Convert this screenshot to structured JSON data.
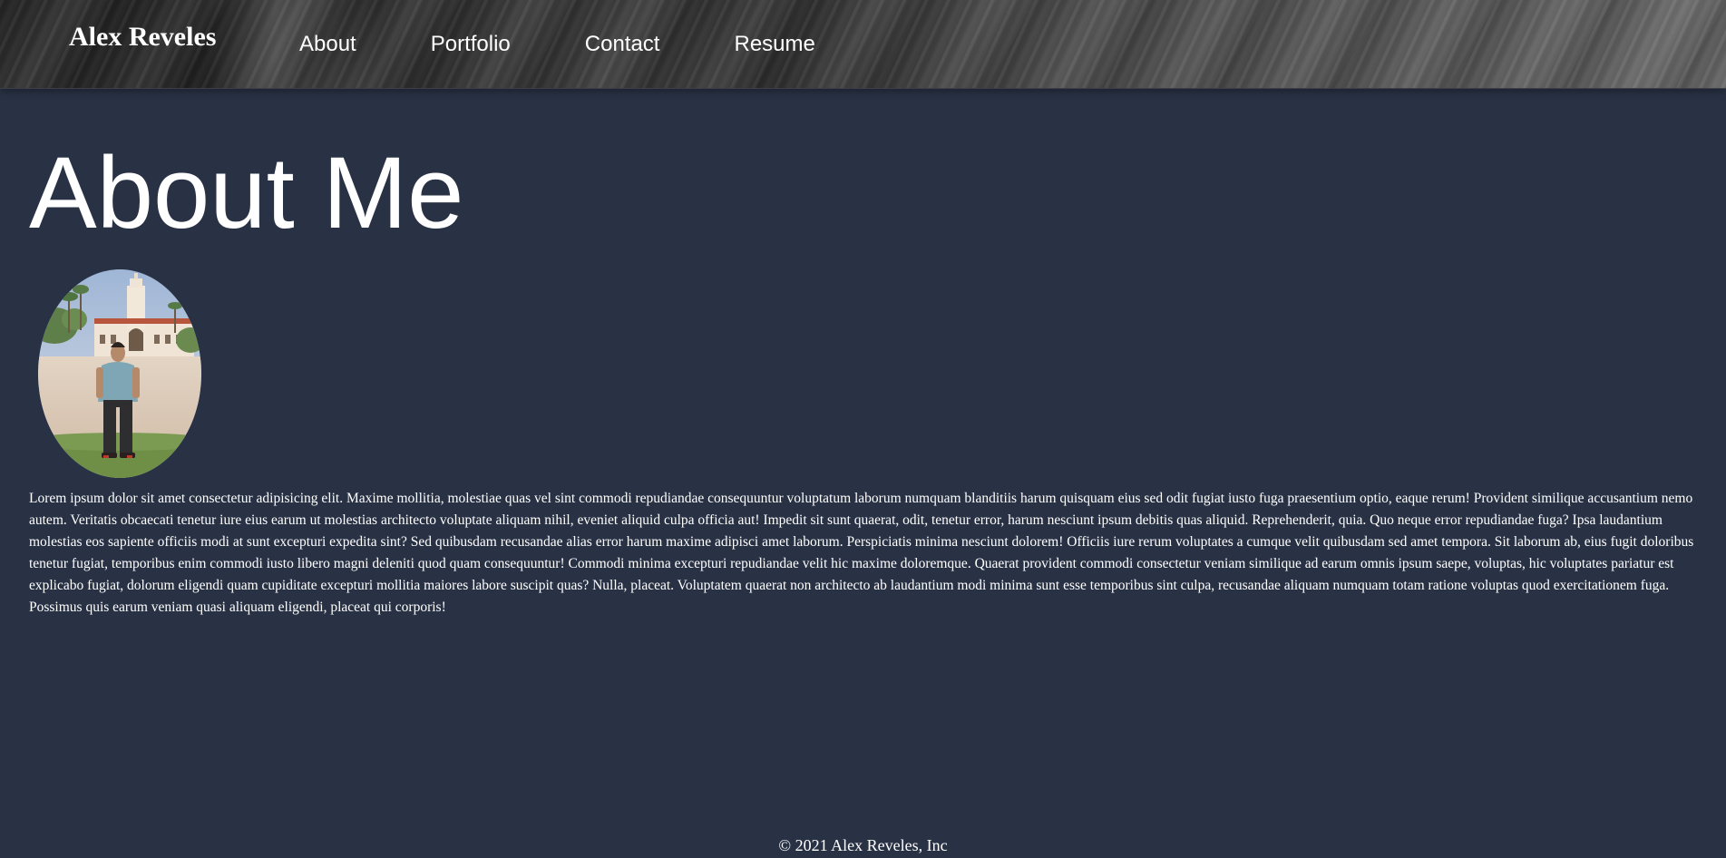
{
  "header": {
    "brand": "Alex Reveles",
    "nav": [
      {
        "label": "About"
      },
      {
        "label": "Portfolio"
      },
      {
        "label": "Contact"
      },
      {
        "label": "Resume"
      }
    ]
  },
  "main": {
    "title": "About Me",
    "photo_icon": "profile-photo",
    "bio": "Lorem ipsum dolor sit amet consectetur adipisicing elit. Maxime mollitia, molestiae quas vel sint commodi repudiandae consequuntur voluptatum laborum numquam blanditiis harum quisquam eius sed odit fugiat iusto fuga praesentium optio, eaque rerum! Provident similique accusantium nemo autem. Veritatis obcaecati tenetur iure eius earum ut molestias architecto voluptate aliquam nihil, eveniet aliquid culpa officia aut! Impedit sit sunt quaerat, odit, tenetur error, harum nesciunt ipsum debitis quas aliquid. Reprehenderit, quia. Quo neque error repudiandae fuga? Ipsa laudantium molestias eos sapiente officiis modi at sunt excepturi expedita sint? Sed quibusdam recusandae alias error harum maxime adipisci amet laborum. Perspiciatis minima nesciunt dolorem! Officiis iure rerum voluptates a cumque velit quibusdam sed amet tempora. Sit laborum ab, eius fugit doloribus tenetur fugiat, temporibus enim commodi iusto libero magni deleniti quod quam consequuntur! Commodi minima excepturi repudiandae velit hic maxime doloremque. Quaerat provident commodi consectetur veniam similique ad earum omnis ipsum saepe, voluptas, hic voluptates pariatur est explicabo fugiat, dolorum eligendi quam cupiditate excepturi mollitia maiores labore suscipit quas? Nulla, placeat. Voluptatem quaerat non architecto ab laudantium modi minima sunt esse temporibus sint culpa, recusandae aliquam numquam totam ratione voluptas quod exercitationem fuga. Possimus quis earum veniam quasi aliquam eligendi, placeat qui corporis!"
  },
  "footer": {
    "copyright": "© 2021 Alex Reveles, Inc"
  },
  "colors": {
    "background": "#293245",
    "text": "#ffffff",
    "header_dark": "#262626",
    "header_light": "#6b6b6b"
  }
}
